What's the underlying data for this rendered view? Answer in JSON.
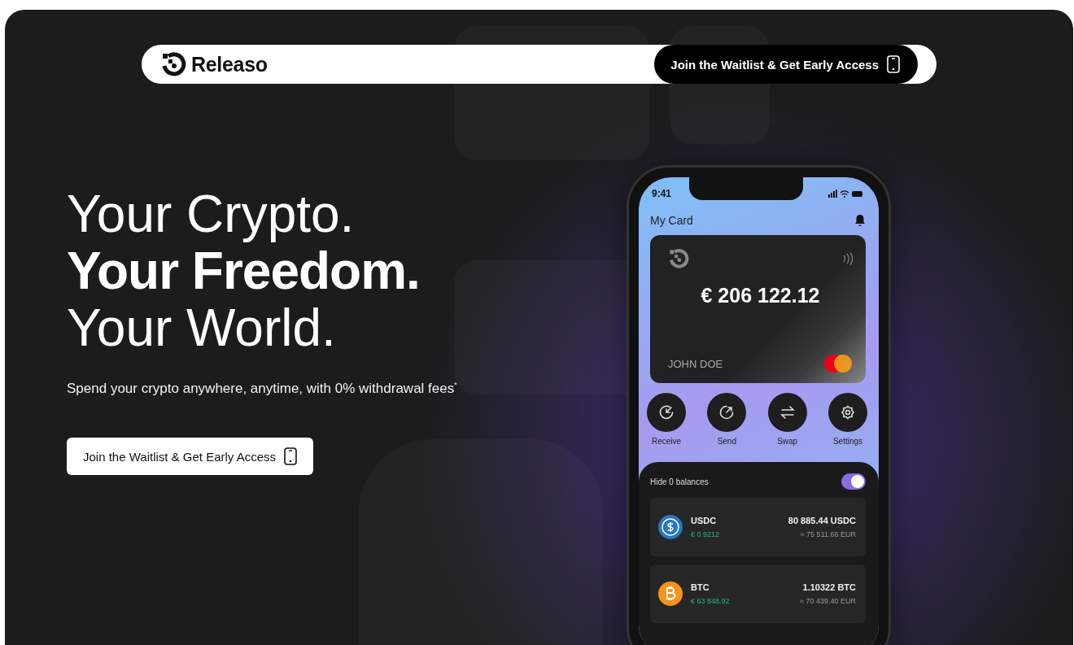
{
  "nav": {
    "brand": "Releaso",
    "cta": "Join the Waitlist & Get Early Access"
  },
  "hero": {
    "headline": [
      {
        "text": "Your Crypto.",
        "kind": "light"
      },
      {
        "text": "Your Freedom.",
        "kind": "bold"
      },
      {
        "text": "Your World.",
        "kind": "light"
      }
    ],
    "subtitle": "Spend your crypto anywhere, anytime, with 0% withdrawal fees$^{*}$",
    "cta": "Join the Waitlist & Get Early Access"
  },
  "phone": {
    "time": "9:41",
    "title": "My Card",
    "card": {
      "amount": "€ 206 122.12",
      "holder": "JOHN DOE"
    },
    "actions": [
      {
        "label": "Receive",
        "kind": "receive"
      },
      {
        "label": "Send",
        "kind": "send"
      },
      {
        "label": "Swap",
        "kind": "swap"
      },
      {
        "label": "Settings",
        "kind": "settings"
      }
    ],
    "hide_zero": {
      "label": "Hide 0 balances",
      "on": true
    },
    "assets": [
      {
        "symbol": "USDC",
        "kind": "usdc",
        "price": "€ 0.9212",
        "amount": "80 885.44 USDC",
        "eur": "≈ 75 511.66 EUR"
      },
      {
        "symbol": "BTC",
        "kind": "btc",
        "price": "€ 63 848.92",
        "amount": "1.10322 BTC",
        "eur": "≈ 70 439.40 EUR"
      }
    ]
  }
}
